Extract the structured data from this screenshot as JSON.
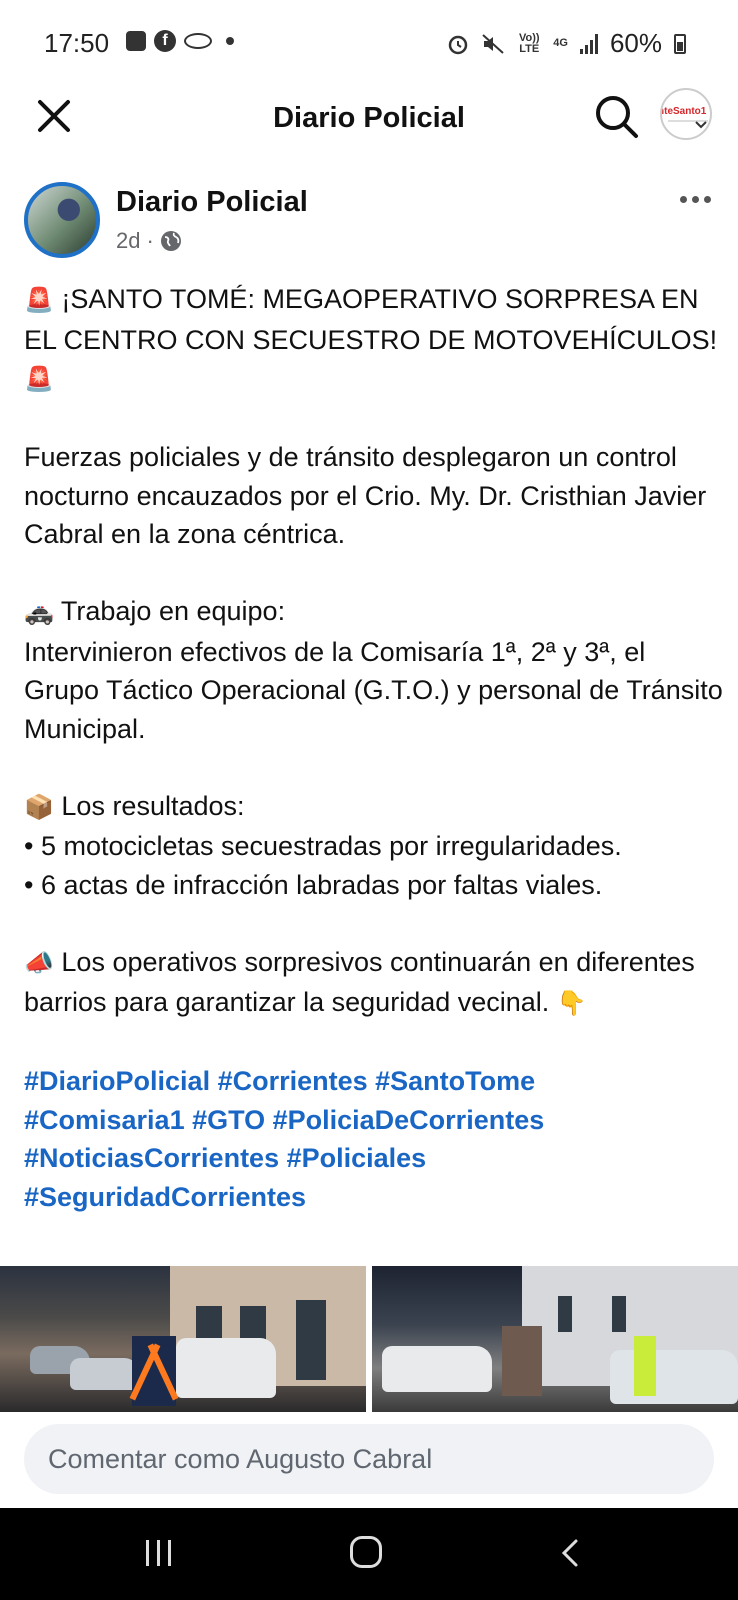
{
  "status_bar": {
    "time": "17:50",
    "volte": "Vo)) LTE",
    "network": "4G",
    "battery": "60%"
  },
  "header": {
    "title": "Diario Policial",
    "page_avatar_text": "nteSanto1"
  },
  "post": {
    "author": "Diario Policial",
    "age": "2d",
    "separator": "·",
    "paragraphs": [
      "¡SANTO TOMÉ: MEGAOPERATIVO SORPRESA EN EL CENTRO CON SECUESTRO DE MOTOVEHÍCULOS!",
      "Fuerzas policiales y de tránsito desplegaron un control nocturno encauzados por el Crio. My. Dr. Cristhian Javier Cabral en la zona céntrica.",
      "Trabajo en equipo:",
      "Intervinieron efectivos de la Comisaría 1ª, 2ª y 3ª, el Grupo Táctico Operacional (G.T.O.) y personal de Tránsito Municipal.",
      "Los resultados:",
      "• 5 motocicletas secuestradas por irregularidades.",
      "• 6 actas de infracción labradas por faltas viales.",
      "Los operativos sorpresivos continuarán en diferentes barrios para garantizar la seguridad vecinal."
    ],
    "emojis": {
      "siren": "🚨",
      "police_car": "🚓",
      "package": "📦",
      "megaphone": "📣",
      "point_down": "👇"
    },
    "hashtags": [
      "#DiarioPolicial #Corrientes #SantoTome",
      "#Comisaria1 #GTO #PoliciaDeCorrientes",
      "#NoticiasCorrientes #Policiales",
      "#SeguridadCorrientes"
    ]
  },
  "comment": {
    "placeholder": "Comentar como Augusto Cabral"
  },
  "icons": {
    "close": "close-icon",
    "search": "search-icon",
    "more": "more-options-icon",
    "globe": "globe-icon",
    "accent": "#1a66c4"
  }
}
